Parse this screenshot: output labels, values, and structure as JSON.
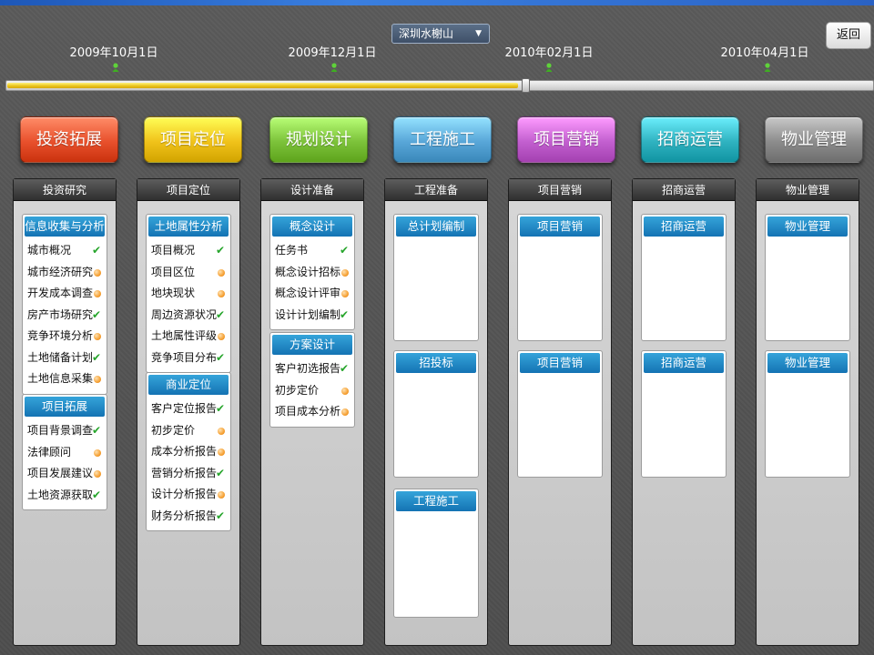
{
  "project_selector": {
    "selected": "深圳水榭山"
  },
  "back_label": "返回",
  "timeline": {
    "dates": [
      "2009年10月1日",
      "2009年12月1日",
      "2010年02月1日",
      "2010年04月1日"
    ],
    "progress": 0.6
  },
  "phase_buttons": [
    {
      "label": "投资拓展",
      "color": "#e8502c"
    },
    {
      "label": "项目定位",
      "color": "#f0c21a"
    },
    {
      "label": "规划设计",
      "color": "#7cc23a"
    },
    {
      "label": "工程施工",
      "color": "#58a6d8"
    },
    {
      "label": "项目营销",
      "color": "#c25fcf"
    },
    {
      "label": "招商运营",
      "color": "#2fb2c0"
    },
    {
      "label": "物业管理",
      "color": "#8c8c8c"
    }
  ],
  "columns": [
    {
      "title": "投资研究",
      "panels": [
        {
          "title": "信息收集与分析",
          "items": [
            {
              "label": "城市概况",
              "status": "done"
            },
            {
              "label": "城市经济研究",
              "status": "pending"
            },
            {
              "label": "开发成本调查",
              "status": "pending"
            },
            {
              "label": "房产市场研究",
              "status": "done"
            },
            {
              "label": "竞争环境分析",
              "status": "pending"
            },
            {
              "label": "土地储备计划",
              "status": "done"
            },
            {
              "label": "土地信息采集",
              "status": "pending"
            }
          ]
        },
        {
          "title": "项目拓展",
          "items": [
            {
              "label": "项目背景调查",
              "status": "done"
            },
            {
              "label": "法律顾问",
              "status": "pending"
            },
            {
              "label": "项目发展建议",
              "status": "pending"
            },
            {
              "label": "土地资源获取",
              "status": "done"
            }
          ]
        }
      ]
    },
    {
      "title": "项目定位",
      "panels": [
        {
          "title": "土地属性分析",
          "items": [
            {
              "label": "项目概况",
              "status": "done"
            },
            {
              "label": "项目区位",
              "status": "pending"
            },
            {
              "label": "地块现状",
              "status": "pending"
            },
            {
              "label": "周边资源状况",
              "status": "done"
            },
            {
              "label": "土地属性评级",
              "status": "pending"
            },
            {
              "label": "竞争项目分布",
              "status": "done"
            }
          ]
        },
        {
          "title": "商业定位",
          "items": [
            {
              "label": "客户定位报告",
              "status": "done"
            },
            {
              "label": "初步定价",
              "status": "pending"
            },
            {
              "label": "成本分析报告",
              "status": "pending"
            },
            {
              "label": "营销分析报告",
              "status": "done"
            },
            {
              "label": "设计分析报告",
              "status": "pending"
            },
            {
              "label": "财务分析报告",
              "status": "done"
            }
          ]
        }
      ]
    },
    {
      "title": "设计准备",
      "panels": [
        {
          "title": "概念设计",
          "items": [
            {
              "label": "任务书",
              "status": "done"
            },
            {
              "label": "概念设计招标",
              "status": "pending"
            },
            {
              "label": "概念设计评审",
              "status": "pending"
            },
            {
              "label": "设计计划编制",
              "status": "done"
            }
          ]
        },
        {
          "title": "方案设计",
          "items": [
            {
              "label": "客户初选报告",
              "status": "done"
            },
            {
              "label": "初步定价",
              "status": "pending"
            },
            {
              "label": "项目成本分析",
              "status": "pending"
            }
          ]
        }
      ]
    },
    {
      "title": "工程准备",
      "panels": [
        {
          "title": "总计划编制",
          "items": []
        },
        {
          "title": "招投标",
          "items": []
        },
        {
          "title": "工程施工",
          "items": []
        }
      ]
    },
    {
      "title": "项目营销",
      "panels": [
        {
          "title": "项目营销",
          "items": []
        },
        {
          "title": "项目营销",
          "items": []
        }
      ]
    },
    {
      "title": "招商运营",
      "panels": [
        {
          "title": "招商运营",
          "items": []
        },
        {
          "title": "招商运营",
          "items": []
        }
      ]
    },
    {
      "title": "物业管理",
      "panels": [
        {
          "title": "物业管理",
          "items": []
        },
        {
          "title": "物业管理",
          "items": []
        }
      ]
    }
  ],
  "icons": {
    "done": "check-icon",
    "pending": "pending-dot-icon",
    "timeline_pin": "pin-icon"
  },
  "colors": {
    "panel_header": "#1f8ac8",
    "done": "#27a52c",
    "pending": "#f59c2b",
    "progress": "#e8c21a"
  }
}
